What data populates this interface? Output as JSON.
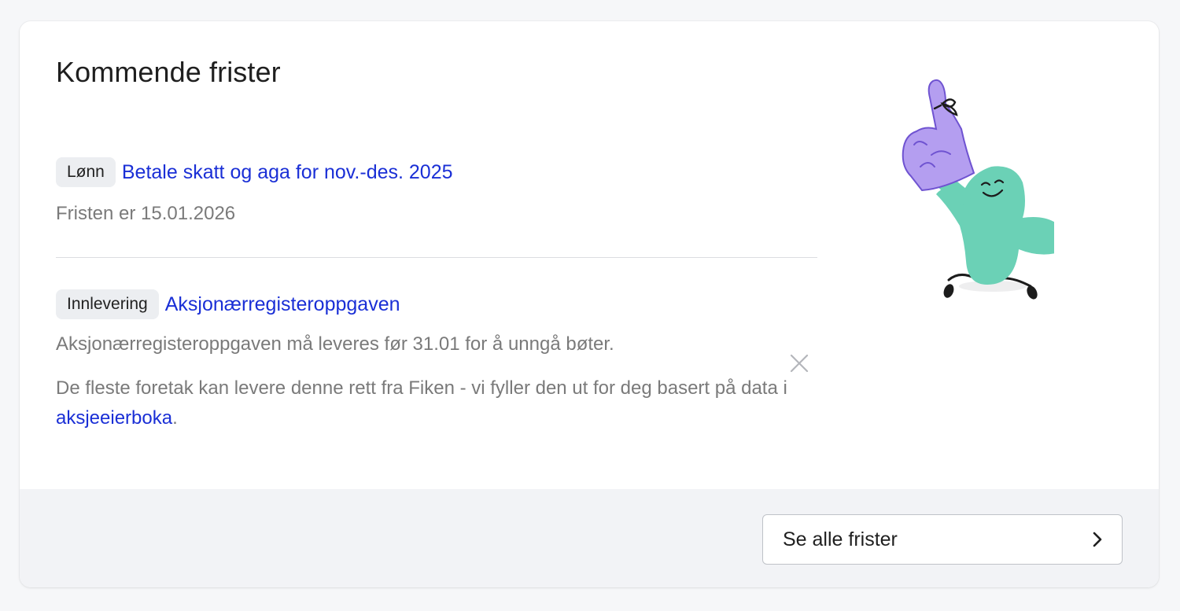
{
  "card": {
    "title": "Kommende frister"
  },
  "deadlines": [
    {
      "tag": "Lønn",
      "title": "Betale skatt og aga for nov.-des. 2025",
      "description": "Fristen er 15.01.2026"
    },
    {
      "tag": "Innlevering",
      "title": "Aksjonærregisteroppgaven",
      "description": "Aksjonærregisteroppgaven må leveres før 31.01 for å unngå bøter.",
      "note_prefix": "De fleste foretak kan levere denne rett fra Fiken - vi fyller den ut for deg basert på data i ",
      "note_link": "aksjeeierboka",
      "note_suffix": "."
    }
  ],
  "icons": {
    "dismiss": "close-icon",
    "see_all": "chevron-right-icon",
    "illustration": "mascot-foam-finger-illustration"
  },
  "footer": {
    "see_all_label": "Se alle frister"
  },
  "colors": {
    "link": "#1a2fd6",
    "tag_bg": "#eceef1",
    "footer_bg": "#f2f3f6",
    "mascot": "#6bd1b6",
    "foam_finger": "#b49ef0"
  }
}
